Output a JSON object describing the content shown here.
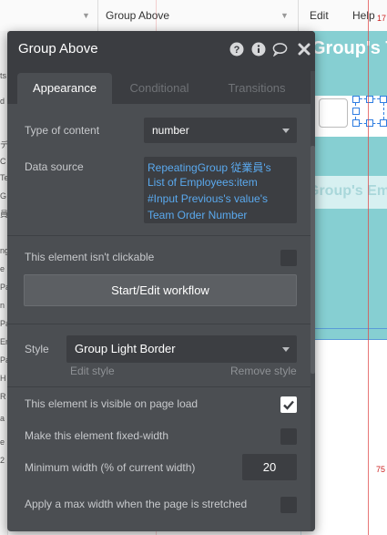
{
  "topbar": {
    "element_label": "Group Above",
    "menu_edit": "Edit",
    "menu_help": "Help"
  },
  "canvas": {
    "header_text": "Group's T",
    "sub_header_text": "Group's Emp",
    "ruler_top": "17",
    "ruler_mid": "75",
    "left_strip_glyphs": [
      "ts",
      "d",
      "デ",
      "C",
      "Te",
      "G",
      "員",
      "ng",
      "e",
      "Pa",
      "n",
      "Pa",
      "En",
      "Pa",
      "H",
      "R",
      "a",
      "e",
      "2"
    ]
  },
  "panel": {
    "title": "Group Above",
    "icons": [
      "question-icon",
      "info-icon",
      "comment-icon",
      "close-icon"
    ],
    "tabs": [
      {
        "label": "Appearance",
        "active": true
      },
      {
        "label": "Conditional",
        "active": false
      },
      {
        "label": "Transitions",
        "active": false
      }
    ],
    "type_of_content_label": "Type of content",
    "type_of_content_value": "number",
    "data_source_label": "Data source",
    "data_source_lines": [
      "RepeatingGroup 従業員's",
      "List of Employees:item",
      "#Input Previous's value's",
      "Team Order Number"
    ],
    "not_clickable_label": "This element isn't clickable",
    "not_clickable_checked": false,
    "workflow_button": "Start/Edit workflow",
    "style_label": "Style",
    "style_value": "Group Light Border",
    "edit_style": "Edit style",
    "remove_style": "Remove style",
    "visible_label": "This element is visible on page load",
    "visible_checked": true,
    "fixed_width_label": "Make this element fixed-width",
    "fixed_width_checked": false,
    "min_width_label": "Minimum width (% of current width)",
    "min_width_value": "20",
    "max_width_label": "Apply a max width when the page is stretched",
    "max_width_checked": false
  },
  "colors": {
    "panel_bg": "#4b4e52",
    "panel_header": "#3b3d41",
    "link_blue": "#5aa9ee",
    "canvas_teal": "#86cfd2"
  }
}
